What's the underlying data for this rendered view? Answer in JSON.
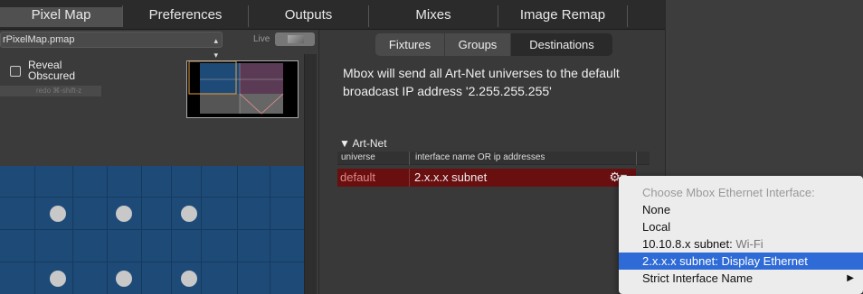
{
  "tabs": [
    "Pixel Map",
    "Preferences",
    "Outputs",
    "Mixes",
    "Image Remap"
  ],
  "left": {
    "file": "rPixelMap.pmap",
    "live": "Live",
    "reveal": "Reveal Obscured",
    "redo": "redo ⌘-shift-z"
  },
  "subtabs": [
    "Fixtures",
    "Groups",
    "Destinations"
  ],
  "message": "Mbox will send all Art-Net universes to the default broadcast IP address  '2.255.255.255'",
  "artnet": {
    "title": "▼ Art-Net",
    "col_universe": "universe",
    "col_iface": "interface name OR ip addresses",
    "row_universe": "default",
    "row_iface": "2.x.x.x subnet"
  },
  "menu": {
    "header": "Choose Mbox Ethernet Interface:",
    "items": [
      {
        "main": "None",
        "sub": ""
      },
      {
        "main": "Local",
        "sub": ""
      },
      {
        "main": "10.10.8.x subnet:",
        "sub": " Wi-Fi"
      },
      {
        "main": "2.x.x.x subnet:",
        "sub": " Display Ethernet"
      },
      {
        "main": "Strict Interface Name",
        "sub": ""
      }
    ]
  },
  "colors": {
    "grid": "#1e4a78",
    "row_selected": "#6a0f10",
    "menu_highlight": "#2f6bd6"
  }
}
